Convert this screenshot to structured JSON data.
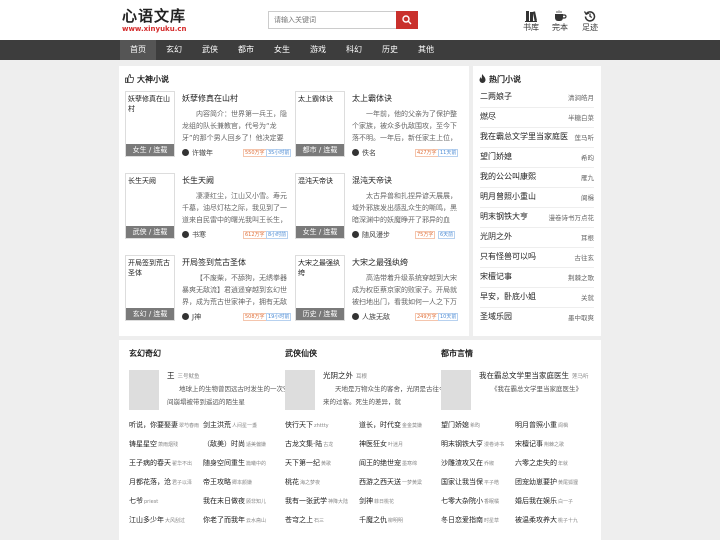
{
  "header": {
    "logo_text": "心语文库",
    "logo_url": "www.xinyuku.cn",
    "search_placeholder": "请输入关键词",
    "icons": [
      {
        "name": "书库",
        "icon": "bookshelf-icon"
      },
      {
        "name": "完本",
        "icon": "coffee-cup-icon"
      },
      {
        "name": "足迹",
        "icon": "history-icon"
      }
    ]
  },
  "nav": [
    "首页",
    "玄幻",
    "武侠",
    "都市",
    "女生",
    "游戏",
    "科幻",
    "历史",
    "其他"
  ],
  "featured": {
    "title": "大神小说",
    "books": [
      {
        "cover_title": "妖孽修真在山村",
        "genre": "女生 / 连载",
        "title": "妖孽修真在山村",
        "desc": "内容简介：世界第一兵王，隐龙组的队长兼教官，代号为“龙牙”的那个男人回乡了！他决定要利用",
        "author": "许辙年",
        "tag1": "550万字",
        "tag2": "35小时前"
      },
      {
        "cover_title": "太上霸体诀",
        "genre": "都市 / 连载",
        "title": "太上霸体诀",
        "desc": "一年前，他的父亲为了保护整个家族，被众多仇敌围攻，至今下落不明。一年后，新任家主上位，",
        "author": "佚名",
        "tag1": "427万字",
        "tag2": "11天前"
      },
      {
        "cover_title": "长生天阙",
        "genre": "武侠 / 连载",
        "title": "长生天阙",
        "desc": "凄凄红尘，江山又小雪。寿元千墓，油尽灯枯之际，我见到了一道来自民雷中的曙光我叫王长生，",
        "author": "书寒",
        "tag1": "612万字",
        "tag2": "8小时前"
      },
      {
        "cover_title": "混沌天帝诀",
        "genre": "女生 / 连载",
        "title": "混沌天帝诀",
        "desc": "太古异兽和扎捏异谚天展展，域外邪族发出感乱众生的嘶鸣，黑暗深渊中的妖魔睁开了邪异的血",
        "author": "随风漫步",
        "tag1": "75万字",
        "tag2": "6天前"
      },
      {
        "cover_title": "开局签到荒古圣体",
        "genre": "玄幻 / 连载",
        "title": "开局签到荒古圣体",
        "desc": "【不废柴，不舔狗，无绣拳器 暴爽无敌流】君逍遥穿越到玄幻世界，成为荒古世家神子，拥有无敌",
        "author": "J神",
        "tag1": "508万字",
        "tag2": "19小时前"
      },
      {
        "cover_title": "大宋之最强纨绔",
        "genre": "历史 / 连载",
        "title": "大宋之最强纨绔",
        "desc": "高浩带着升级系统穿越到大宋成为权臣蔡京家的败家子。开局就被扫地出门，看我如何一人之下万人之上。别人得到",
        "author": "人族无敌",
        "tag1": "249万字",
        "tag2": "10天前"
      }
    ]
  },
  "hot": {
    "title": "热门小说",
    "items": [
      {
        "name": "二两娘子",
        "author": "清涧皓月"
      },
      {
        "name": "燃尽",
        "author": "半糖白菜"
      },
      {
        "name": "我在霸总文学里当家庭医",
        "author": "莲马听"
      },
      {
        "name": "望门娇媳",
        "author": "希昀"
      },
      {
        "name": "我的公公叫康熙",
        "author": "雁九"
      },
      {
        "name": "明月曾照小重山",
        "author": "阆楫"
      },
      {
        "name": "明末钢铁大亨",
        "author": "漫卷诗书万点花"
      },
      {
        "name": "光阴之外",
        "author": "耳根"
      },
      {
        "name": "只有怪兽可以吗",
        "author": "古往玄"
      },
      {
        "name": "宋檀记事",
        "author": "荆棘之歌"
      },
      {
        "name": "早安，卧底小姐",
        "author": "关就"
      },
      {
        "name": "圣域乐园",
        "author": "墨中取爽"
      }
    ]
  },
  "columns": [
    {
      "title": "玄幻奇幻",
      "featured": {
        "name": "王",
        "author": "三号鱿鱼",
        "desc": "地球上的生物曾因远古时发生的一次空间崩塌被带到遥远的陌生星"
      },
      "list": [
        [
          "听说，你要娶妻",
          "翠芍春雨"
        ],
        [
          "剑主洪荒",
          "人间星一盞"
        ],
        [
          "铸星星空",
          "萧雨烟残"
        ],
        [
          "（敌美）时尚",
          "适美偏嫌"
        ],
        [
          "王子病的春天",
          "翟华不出"
        ],
        [
          "随身空间重生",
          "篇曦中的"
        ],
        [
          "月都花落，沧",
          "君子以泽"
        ],
        [
          "帝王攻略",
          "卿本颜嫌"
        ],
        [
          "七爷",
          "priest"
        ],
        [
          "我在末日做夜",
          "顾非知儿"
        ],
        [
          "江山多少年",
          "大风刮过"
        ],
        [
          "你老了而我年",
          "云水斋山"
        ]
      ]
    },
    {
      "title": "武侠仙侠",
      "featured": {
        "name": "光阴之外",
        "author": "耳根",
        "desc": "天地是万物众生的客舍，光阴是古往今来的过客。死生的差异，就"
      },
      "list": [
        [
          "侠行天下",
          "zhttty"
        ],
        [
          "道长，时代变",
          "金金莫嫌"
        ],
        [
          "古龙文集·陆",
          "古龙"
        ],
        [
          "神医狂女",
          "叶迷月"
        ],
        [
          "天下第一纪",
          "黄歌"
        ],
        [
          "阎王的绝世宠",
          "墨寒绵"
        ],
        [
          "桃花",
          "海之梦夜"
        ],
        [
          "西游之西天送",
          "一梦黄粱"
        ],
        [
          "我有一张武学",
          "神降大陆"
        ],
        [
          "剑神",
          "菲日桃花"
        ],
        [
          "苍穹之上",
          "石三"
        ],
        [
          "千魔之仇",
          "柳明明"
        ]
      ]
    },
    {
      "title": "都市言情",
      "featured": {
        "name": "我在霸总文学里当家庭医生",
        "author": "莲马听",
        "desc": "《我在霸总文学里当家庭医生》"
      },
      "list": [
        [
          "望门娇媳",
          "希昀"
        ],
        [
          "明月曾照小重",
          "阆楫"
        ],
        [
          "明末钢铁大亨",
          "漫卷诗书"
        ],
        [
          "宋檀记事",
          "荆棘之歌"
        ],
        [
          "沙雕渣攻又在",
          "乔椒"
        ],
        [
          "六零之走失的",
          "年就"
        ],
        [
          "国家让我当保",
          "平子皓"
        ],
        [
          "团宠幼崽要护",
          "黄尾狐狸"
        ],
        [
          "七零大杂院小",
          "香眠橘"
        ],
        [
          "婚后我在娱乐",
          "白一子"
        ],
        [
          "冬日恋爱指南",
          "时星草"
        ],
        [
          "被温柔攻养大",
          "桃子十九"
        ]
      ]
    }
  ]
}
